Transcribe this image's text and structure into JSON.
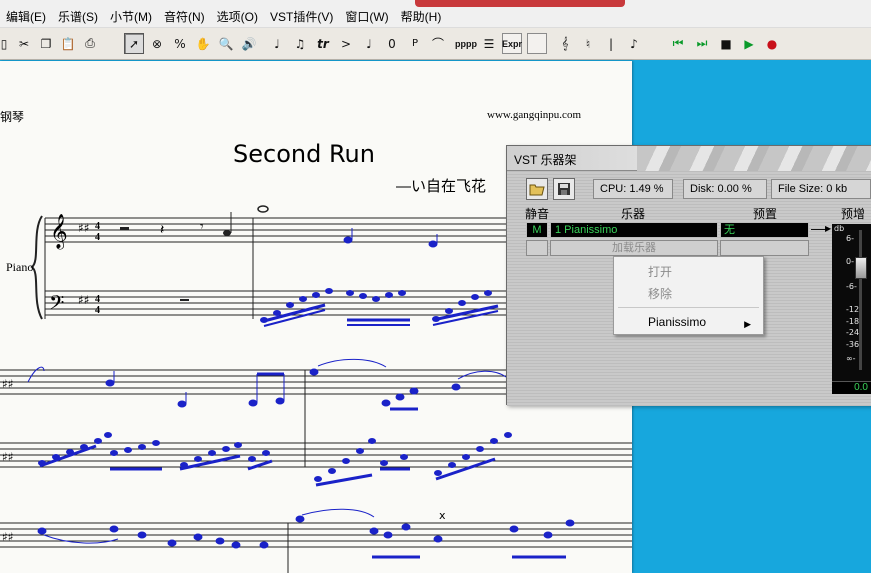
{
  "menubar": {
    "items": [
      "编辑(E)",
      "乐谱(S)",
      "小节(M)",
      "音符(N)",
      "选项(O)",
      "VST插件(V)",
      "窗口(W)",
      "帮助(H)"
    ]
  },
  "toolbar": {
    "tools": [
      "trill-tool-label",
      "tr",
      "ppp-label",
      "Expr"
    ],
    "tr_label": "tr",
    "zero_label": "0",
    "p_label": "P",
    "pppp_label": "pppp",
    "expr_label": "Expr",
    "percent_label": "%"
  },
  "score": {
    "header_left": "钢琴",
    "website": "www.gangqinpu.com",
    "title": "Second Run",
    "subtitle": "—い自在飞花",
    "instrument": "Piano"
  },
  "vst_rack": {
    "title": "VST 乐器架",
    "cpu": "CPU: 1.49 %",
    "disk": "Disk: 0.00 %",
    "file_size": "File Size: 0 kb",
    "columns": {
      "mute": "静音",
      "instrument": "乐器",
      "preset": "预置",
      "gain": "预增益"
    },
    "rows": [
      {
        "mute": "M",
        "instrument": "1  Pianissimo",
        "preset": "无"
      }
    ],
    "add_instrument": "加载乐器",
    "meter_labels": [
      "db",
      "6-",
      "0-",
      "-6-",
      "-12-",
      "-18-",
      "-24-",
      "-36-",
      "∞-"
    ],
    "gain_value": "0.0"
  },
  "context_menu": {
    "items": [
      {
        "label": "打开",
        "disabled": true
      },
      {
        "label": "移除",
        "disabled": true
      },
      {
        "label": "Pianissimo",
        "disabled": false,
        "submenu": true
      }
    ]
  },
  "colors": {
    "desktop": "#17a7dd",
    "note_blue": "#1a22c8",
    "play_green": "#0a9a2a",
    "record_red": "#c8101a",
    "meter_green": "#39d35a"
  }
}
